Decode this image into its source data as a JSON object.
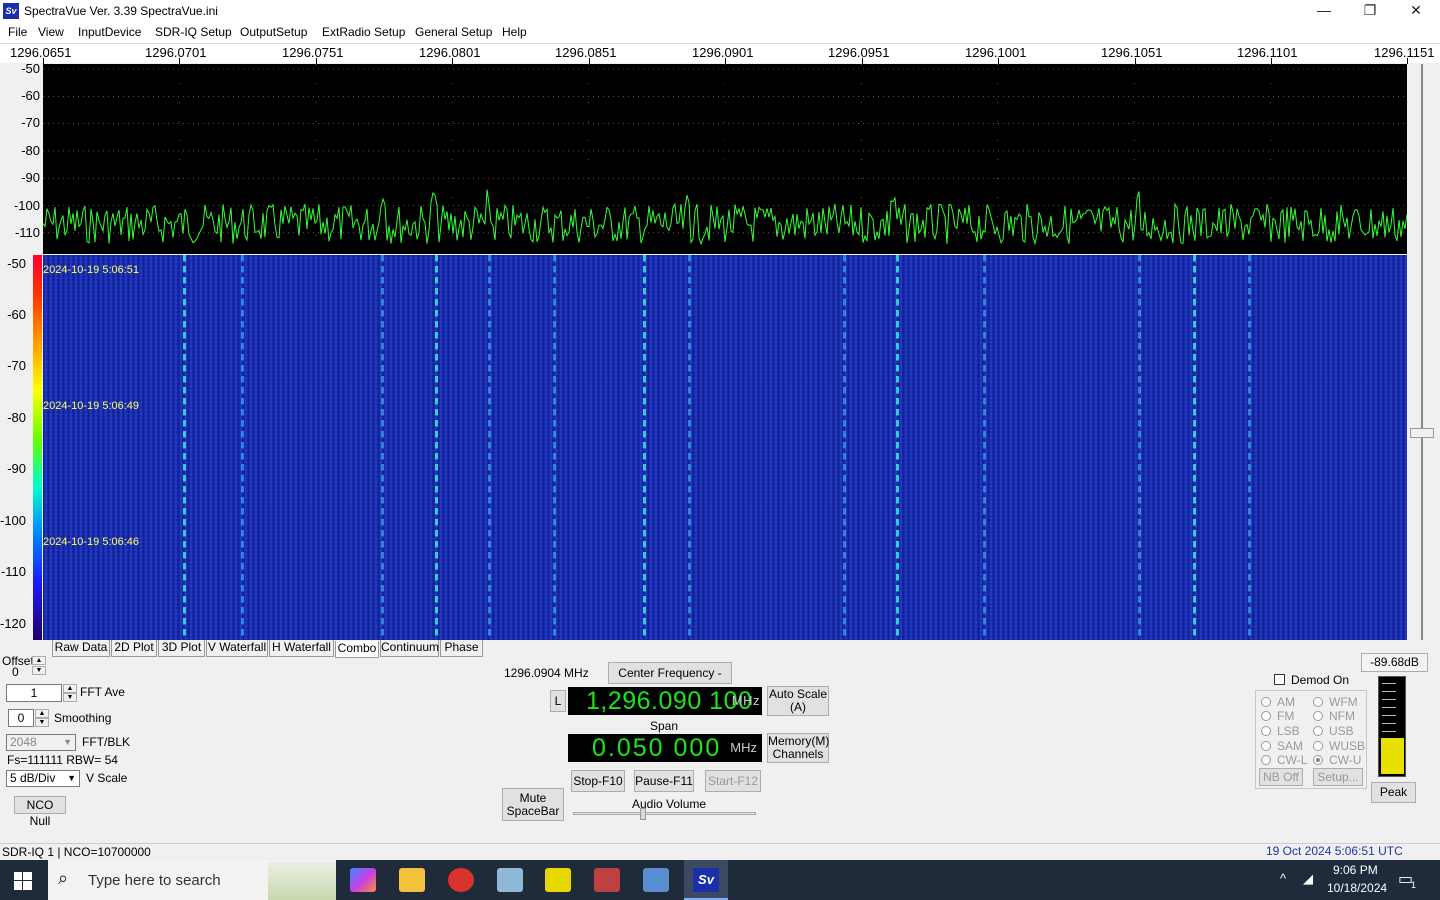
{
  "window": {
    "title": "SpectraVue Ver. 3.39  SpectraVue.ini",
    "icon": "Sv"
  },
  "menu": [
    "File",
    "View",
    "InputDevice",
    "SDR-IQ Setup",
    "OutputSetup",
    "ExtRadio Setup",
    "General Setup",
    "Help"
  ],
  "ruler": [
    "1296.0651",
    "1296.0701",
    "1296.0751",
    "1296.0801",
    "1296.0851",
    "1296.0901",
    "1296.0951",
    "1296.1001",
    "1296.1051",
    "1296.1101",
    "1296.1151"
  ],
  "spectrum_y": [
    "-50",
    "-60",
    "-70",
    "-80",
    "-90",
    "-100",
    "-110"
  ],
  "waterfall_y": [
    "-50",
    "-60",
    "-70",
    "-80",
    "-90",
    "-100",
    "-110",
    "-120"
  ],
  "waterfall_times": [
    "2024-10-19 5:06:51",
    "2024-10-19 5:06:49",
    "2024-10-19 5:06:46"
  ],
  "tabs": [
    "Raw Data",
    "2D Plot",
    "3D Plot",
    "V Waterfall",
    "H Waterfall",
    "Combo",
    "Continuum",
    "Phase"
  ],
  "active_tab": "Combo",
  "controls": {
    "offset_label": "Offset",
    "offset_value": "0",
    "fft_ave_value": "1",
    "fft_ave_label": "FFT Ave",
    "smoothing_value": "0",
    "smoothing_label": "Smoothing",
    "fft_blk_value": "2048",
    "fft_blk_label": "FFT/BLK",
    "fs_rbw": "Fs=111111 RBW=  54",
    "vscale_value": "5 dB/Div",
    "vscale_label": "V Scale",
    "nco_null": "NCO Null",
    "cursor_freq": "1296.0904 MHz",
    "center_freq_btn": "Center Frequency - Ins",
    "l_btn": "L",
    "freq_display": "1,296.090 100",
    "freq_unit": "MHz",
    "auto_scale": "Auto Scale\n(A)",
    "span_label": "Span",
    "span_display": "0.050 000",
    "span_unit": "MHz",
    "memory_btn": "Memory(M)\nChannels",
    "stop_btn": "Stop-F10",
    "pause_btn": "Pause-F11",
    "start_btn": "Start-F12",
    "mute_btn": "Mute\nSpaceBar",
    "audio_volume": "Audio Volume",
    "demod_on": "Demod On",
    "demod_left": [
      "AM",
      "FM",
      "LSB",
      "SAM",
      "CW-L"
    ],
    "demod_right": [
      "WFM",
      "NFM",
      "USB",
      "WUSB",
      "CW-U"
    ],
    "demod_selected": "CW-U",
    "nb_off": "NB Off",
    "setup_btn": "Setup...",
    "level_db": "-89.68dB",
    "peak_btn": "Peak"
  },
  "status": {
    "left": "SDR-IQ 1  |   NCO=10700000",
    "right": "19 Oct 2024  5:06:51 UTC"
  },
  "taskbar": {
    "search_placeholder": "Type here to search",
    "time": "9:06 PM",
    "date": "10/18/2024",
    "notif_count": "1"
  },
  "colors": {
    "spectrum_trace": "#33ff33",
    "waterfall_bg": "#1830c8",
    "status_right": "#1a3aa8"
  }
}
